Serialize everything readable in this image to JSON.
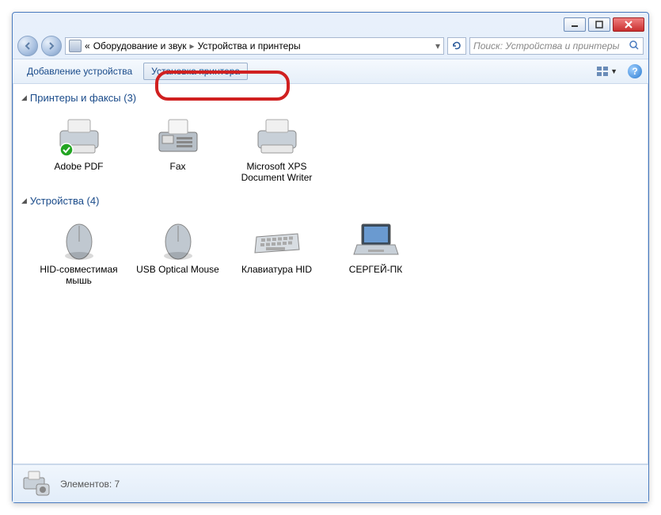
{
  "breadcrumb": {
    "prefix": "«",
    "part1": "Оборудование и звук",
    "part2": "Устройства и принтеры"
  },
  "search": {
    "placeholder": "Поиск: Устройства и принтеры"
  },
  "toolbar": {
    "add_device": "Добавление устройства",
    "install_printer": "Установка принтера"
  },
  "groups": [
    {
      "title": "Принтеры и факсы (3)",
      "items": [
        {
          "name": "Adobe PDF",
          "icon": "printer-default"
        },
        {
          "name": "Fax",
          "icon": "fax"
        },
        {
          "name": "Microsoft XPS Document Writer",
          "icon": "printer"
        }
      ]
    },
    {
      "title": "Устройства (4)",
      "items": [
        {
          "name": "HID-совместимая мышь",
          "icon": "mouse"
        },
        {
          "name": "USB Optical Mouse",
          "icon": "mouse"
        },
        {
          "name": "Клавиатура HID",
          "icon": "keyboard"
        },
        {
          "name": "СЕРГЕЙ-ПК",
          "icon": "laptop"
        }
      ]
    }
  ],
  "statusbar": {
    "text": "Элементов: 7"
  }
}
